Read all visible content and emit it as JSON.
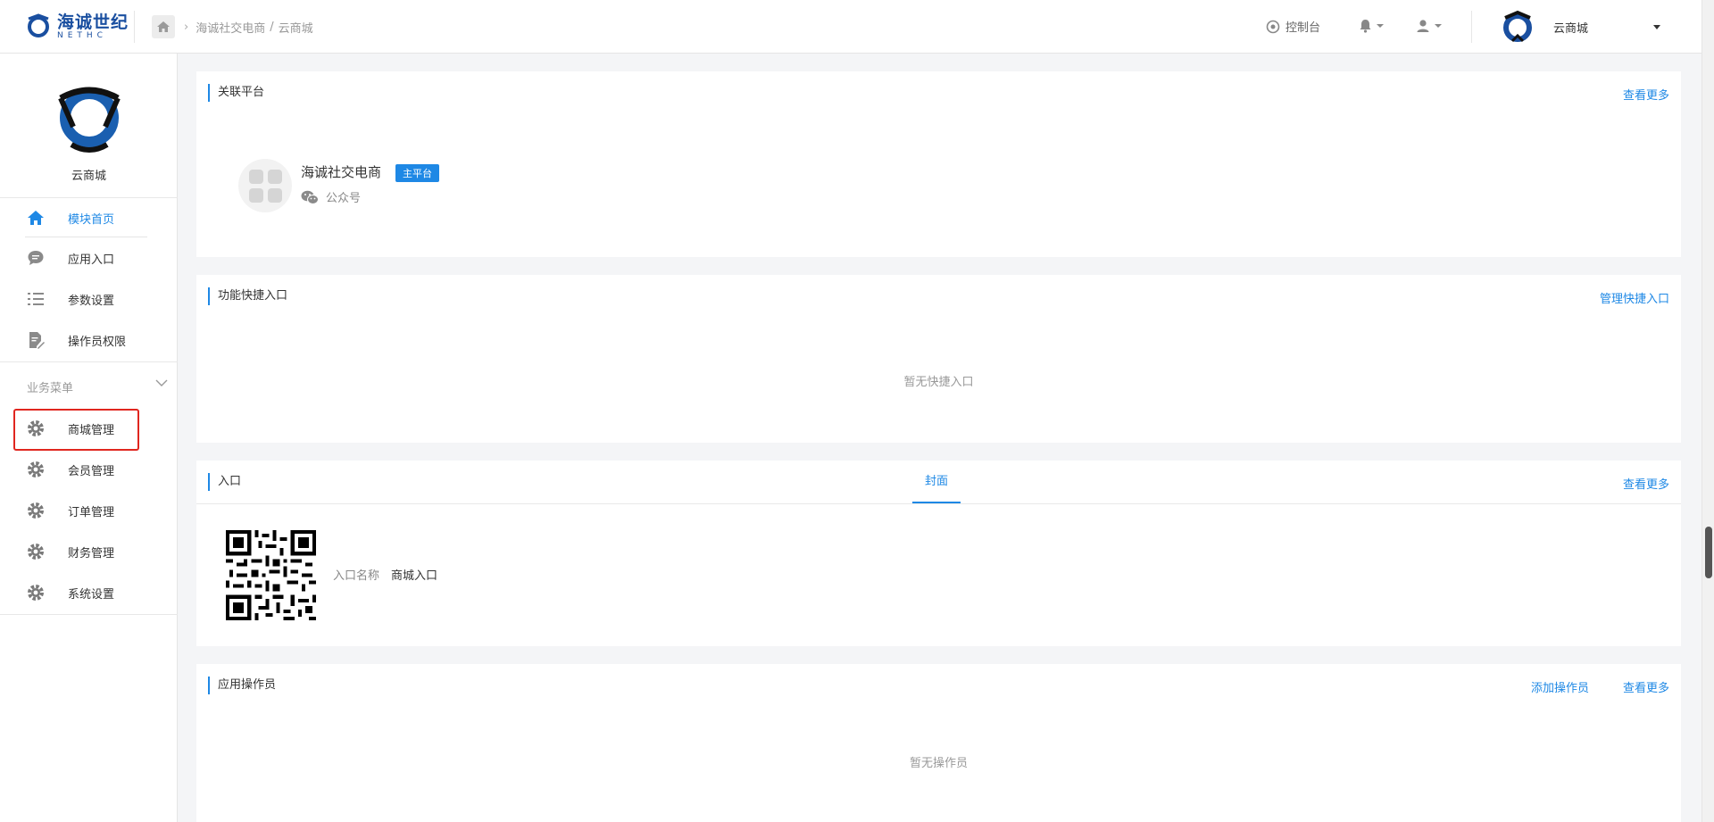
{
  "header": {
    "logo_cn": "海诚世纪",
    "logo_en": "NETHC",
    "breadcrumb": {
      "parent": "海诚社交电商",
      "current": "云商城"
    },
    "console_label": "控制台",
    "account_name": "云商城"
  },
  "sidebar": {
    "app_name": "云商城",
    "nav": [
      {
        "label": "模块首页",
        "icon": "home-icon"
      },
      {
        "label": "应用入口",
        "icon": "chat-bubble-icon"
      },
      {
        "label": "参数设置",
        "icon": "list-settings-icon"
      },
      {
        "label": "操作员权限",
        "icon": "document-edit-icon"
      }
    ],
    "section_title": "业务菜单",
    "business": [
      {
        "label": "商城管理",
        "icon": "gear-icon"
      },
      {
        "label": "会员管理",
        "icon": "gear-icon"
      },
      {
        "label": "订单管理",
        "icon": "gear-icon"
      },
      {
        "label": "财务管理",
        "icon": "gear-icon"
      },
      {
        "label": "系统设置",
        "icon": "gear-icon"
      }
    ]
  },
  "cards": {
    "platform": {
      "title": "关联平台",
      "link": "查看更多",
      "name": "海诚社交电商",
      "badge": "主平台",
      "type": "公众号"
    },
    "shortcuts": {
      "title": "功能快捷入口",
      "link": "管理快捷入口",
      "empty": "暂无快捷入口"
    },
    "entry": {
      "title": "入口",
      "tab": "封面",
      "link": "查看更多",
      "name_label": "入口名称",
      "name_value": "商城入口"
    },
    "operators": {
      "title": "应用操作员",
      "add_link": "添加操作员",
      "link": "查看更多",
      "empty": "暂无操作员"
    }
  },
  "colors": {
    "accent": "#1e88e5",
    "highlight": "#e0261f",
    "logo_blue": "#1a4fa0"
  }
}
